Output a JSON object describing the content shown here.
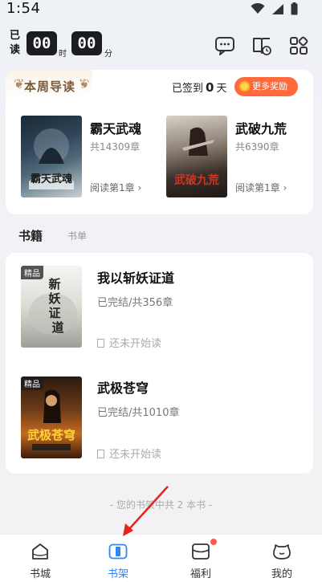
{
  "status_bar": {
    "time": "1:54"
  },
  "timer": {
    "read_label_1": "已",
    "read_label_2": "读",
    "hours": "00",
    "hours_unit": "时",
    "minutes": "00",
    "minutes_unit": "分"
  },
  "weekly": {
    "title": "本周导读",
    "checkin_prefix": "已签到",
    "checkin_days": "0",
    "checkin_suffix": "天",
    "reward_button": "更多奖励",
    "books": [
      {
        "title": "霸天武魂",
        "chapters": "共14309章",
        "action": "阅读第1章 ›"
      },
      {
        "title": "武破九荒",
        "chapters": "共6390章",
        "action": "阅读第1章 ›"
      }
    ]
  },
  "tabs": {
    "active": "书籍",
    "inactive": "书单"
  },
  "shelf": {
    "badge": "精品",
    "books": [
      {
        "title": "我以斩妖证道",
        "meta": "已完结/共356章",
        "status": "还未开始读"
      },
      {
        "title": "武极苍穹",
        "meta": "已完结/共1010章",
        "status": "还未开始读"
      }
    ],
    "footer": "- 您的书架中共 2 本书 -"
  },
  "nav": {
    "items": [
      {
        "label": "书城",
        "icon": "bookstore-icon"
      },
      {
        "label": "书架",
        "icon": "bookshelf-icon"
      },
      {
        "label": "福利",
        "icon": "welfare-icon"
      },
      {
        "label": "我的",
        "icon": "profile-icon"
      }
    ],
    "active_index": 1,
    "accent": "#2f86f6"
  }
}
